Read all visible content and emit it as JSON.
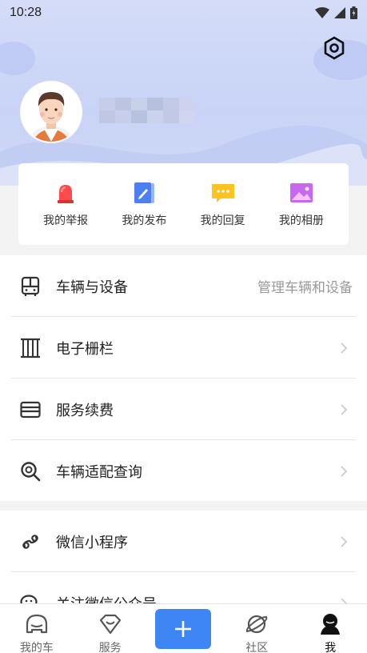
{
  "status_bar": {
    "time": "10:28"
  },
  "profile": {
    "avatar_icon": "male-avatar"
  },
  "quick_actions": [
    {
      "label": "我的举报",
      "icon": "alarm-light-icon"
    },
    {
      "label": "我的发布",
      "icon": "edit-note-icon"
    },
    {
      "label": "我的回复",
      "icon": "chat-bubble-icon"
    },
    {
      "label": "我的相册",
      "icon": "photo-album-icon"
    }
  ],
  "menu_group_1": [
    {
      "label": "车辆与设备",
      "sub": "管理车辆和设备",
      "icon": "bus-icon"
    },
    {
      "label": "电子栅栏",
      "sub": "",
      "icon": "fence-icon"
    },
    {
      "label": "服务续费",
      "sub": "",
      "icon": "card-icon"
    },
    {
      "label": "车辆适配查询",
      "sub": "",
      "icon": "magnifier-icon"
    }
  ],
  "menu_group_2": [
    {
      "label": "微信小程序",
      "icon": "mini-program-icon"
    },
    {
      "label": "关注微信公众号",
      "icon": "wechat-official-icon"
    }
  ],
  "tabbar": [
    {
      "label": "我的车",
      "icon": "car-icon"
    },
    {
      "label": "服务",
      "icon": "service-icon"
    },
    {
      "label": "",
      "icon": "plus-icon"
    },
    {
      "label": "社区",
      "icon": "planet-icon"
    },
    {
      "label": "我",
      "icon": "person-icon",
      "active": true
    }
  ],
  "colors": {
    "accent": "#3f86f5",
    "header_bg": "#cdd6f6"
  }
}
